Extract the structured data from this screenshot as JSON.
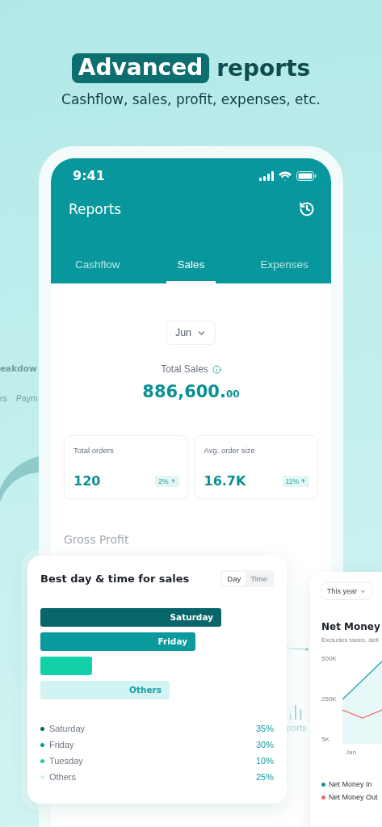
{
  "headline": {
    "highlight": "Advanced",
    "rest": "reports",
    "subtitle": "Cashflow, sales, profit, expenses, etc."
  },
  "background_card": {
    "title": "eakdow",
    "tabs": [
      "rs",
      "Paym"
    ]
  },
  "phone": {
    "status_time": "9:41",
    "title": "Reports",
    "tabs": [
      {
        "label": "Cashflow",
        "selected": false
      },
      {
        "label": "Sales",
        "selected": true
      },
      {
        "label": "Expenses",
        "selected": false
      }
    ],
    "period": "Jun",
    "total_label": "Total Sales",
    "total_main": "886,600.",
    "total_cents": "00",
    "stats": [
      {
        "label": "Total orders",
        "value": "120",
        "change": "2%"
      },
      {
        "label": "Avg. order size",
        "value": "16.7K",
        "change": "11%"
      }
    ],
    "section_title": "Gross Profit",
    "nav_label": "ports"
  },
  "sales_card": {
    "title": "Best day & time for sales",
    "segments": [
      {
        "label": "Day",
        "selected": true
      },
      {
        "label": "Time",
        "selected": false
      }
    ],
    "bars": [
      {
        "label": "Saturday",
        "color": "#08666a"
      },
      {
        "label": "Friday",
        "color": "#0a9a9e"
      },
      {
        "color": "#12d0a8"
      },
      {
        "label": "Others",
        "color": "#d2f3f3"
      }
    ],
    "legend": [
      {
        "label": "Saturday",
        "value": "35%",
        "color": "#08666a"
      },
      {
        "label": "Friday",
        "value": "30%",
        "color": "#0a9a9e"
      },
      {
        "label": "Tuesday",
        "value": "10%",
        "color": "#12d0a8"
      },
      {
        "label": "Others",
        "value": "25%",
        "color": "#d2f3f3"
      }
    ]
  },
  "net_money_card": {
    "period": "This year",
    "title": "Net Money",
    "subtitle": "Excludes taxes, deli",
    "yticks": [
      "500K",
      "250K",
      "5K"
    ],
    "xticks": [
      "Jan"
    ],
    "legend": [
      {
        "label": "Net Money In",
        "color": "#0a9a9e"
      },
      {
        "label": "Net Money Out",
        "color": "#f06a6a"
      }
    ]
  }
}
